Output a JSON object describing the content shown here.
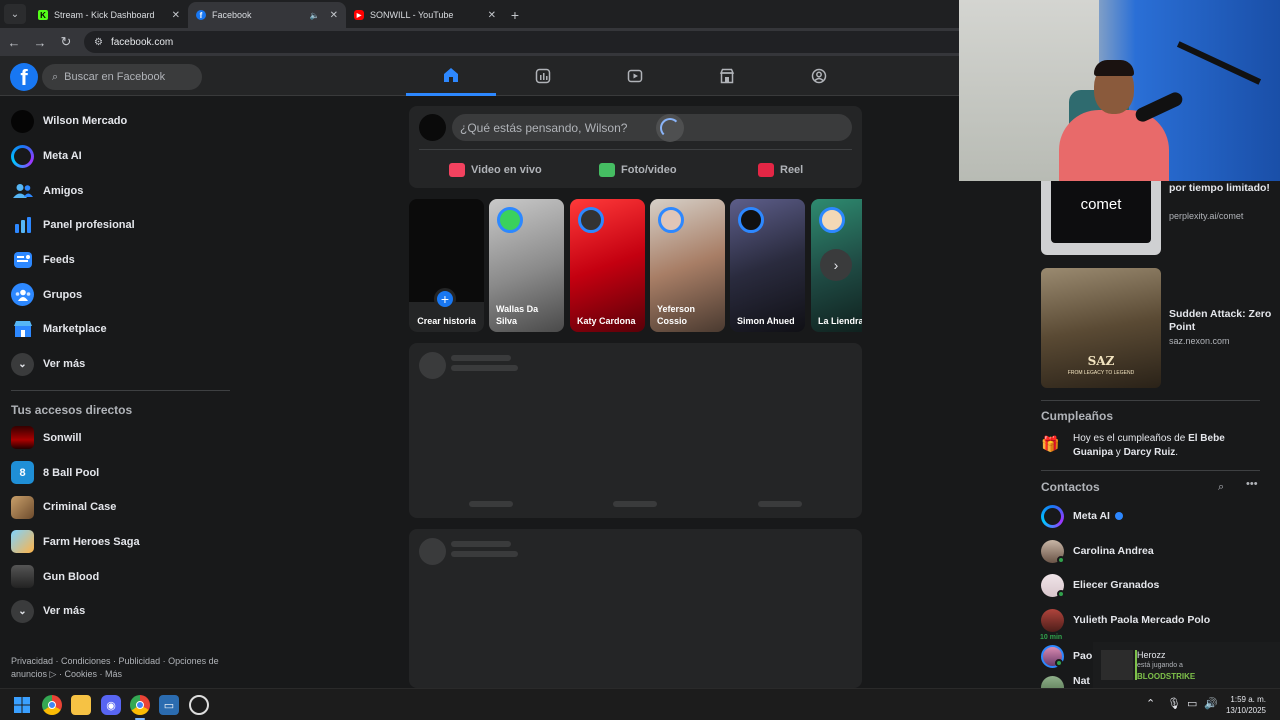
{
  "browser": {
    "tabs": [
      {
        "title": "Stream - Kick Dashboard",
        "icon": "kick-icon",
        "color": "#53fc18"
      },
      {
        "title": "Facebook",
        "icon": "facebook-icon",
        "color": "#1877f2"
      },
      {
        "title": "SONWILL - YouTube",
        "icon": "youtube-icon",
        "color": "#ff0000"
      }
    ],
    "url": "facebook.com"
  },
  "fb": {
    "search_placeholder": "Buscar en Facebook",
    "nav": [
      "home-icon",
      "dashboard-icon",
      "video-icon",
      "marketplace-icon",
      "gaming-icon"
    ]
  },
  "sidebar": {
    "items": [
      {
        "label": "Wilson Mercado",
        "icon": "profile-avatar"
      },
      {
        "label": "Meta AI",
        "icon": "meta-ai-icon"
      },
      {
        "label": "Amigos",
        "icon": "friends-icon"
      },
      {
        "label": "Panel profesional",
        "icon": "dashboard-icon"
      },
      {
        "label": "Feeds",
        "icon": "feeds-icon"
      },
      {
        "label": "Grupos",
        "icon": "groups-icon"
      },
      {
        "label": "Marketplace",
        "icon": "marketplace-icon"
      },
      {
        "label": "Ver más",
        "icon": "chevron-down-icon"
      }
    ],
    "shortcuts_title": "Tus accesos directos",
    "shortcuts": [
      {
        "label": "Sonwill"
      },
      {
        "label": "8 Ball Pool"
      },
      {
        "label": "Criminal Case"
      },
      {
        "label": "Farm Heroes Saga"
      },
      {
        "label": "Gun Blood"
      },
      {
        "label": "Ver más"
      }
    ],
    "footer_line1": "Privacidad · Condiciones · Publicidad · Opciones de",
    "footer_line2": "anuncios ▷ · Cookies · Más"
  },
  "composer": {
    "placeholder": "¿Qué estás pensando, Wilson?",
    "live": "Video en vivo",
    "photo": "Foto/video",
    "reel": "Reel"
  },
  "stories": [
    {
      "name": "Crear historia"
    },
    {
      "name": "Wallas Da Silva"
    },
    {
      "name": "Katy Cardona"
    },
    {
      "name": "Yeferson Cossio"
    },
    {
      "name": "Simon Ahued"
    },
    {
      "name": "La Liendra"
    }
  ],
  "ads": [
    {
      "title": "por tiempo limitado!",
      "domain": "perplexity.ai/comet",
      "brand": "comet"
    },
    {
      "title": "Sudden Attack: Zero Point",
      "domain": "saz.nexon.com",
      "brand": "SAZ",
      "tagline": "FROM LEGACY TO LEGEND"
    }
  ],
  "birthdays": {
    "title": "Cumpleaños",
    "prefix": "Hoy es el cumpleaños de ",
    "name1": "El Bebe Guanipa",
    "mid": " y ",
    "name2": "Darcy Ruiz",
    "suffix": "."
  },
  "contacts": {
    "title": "Contactos",
    "items": [
      {
        "name": "Meta AI"
      },
      {
        "name": "Carolina Andrea"
      },
      {
        "name": "Eliecer Granados"
      },
      {
        "name": "Yulieth Paola Mercado Polo",
        "status": "10 min"
      },
      {
        "name": "Paol"
      },
      {
        "name": "Nat"
      }
    ]
  },
  "toast": {
    "name": "Herozz",
    "status": "está jugando a",
    "game": "BLOODSTRIKE"
  },
  "clock": {
    "time": "1:59 a. m.",
    "date": "13/10/2025"
  }
}
